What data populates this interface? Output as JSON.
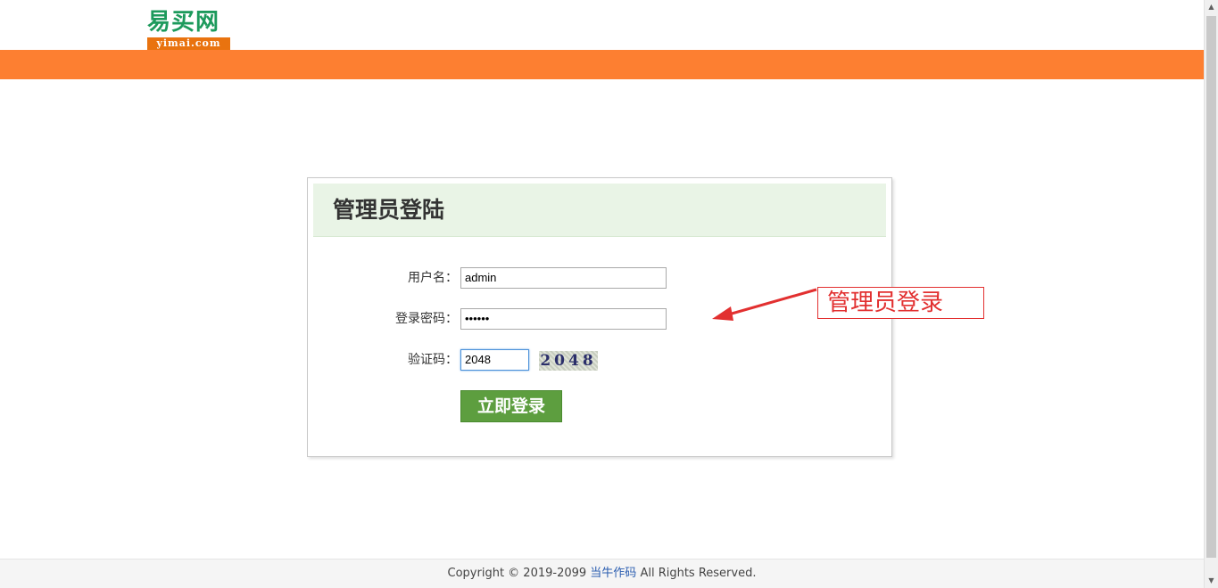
{
  "header": {
    "logo_cn": "易买网",
    "logo_en": "yimai.com"
  },
  "login": {
    "title": "管理员登陆",
    "username_label": "用户名：",
    "username_value": "admin",
    "password_label": "登录密码：",
    "password_value": "••••••",
    "captcha_label": "验证码：",
    "captcha_value": "2048",
    "captcha_image_text": "2048",
    "submit_label": "立即登录"
  },
  "annotation": {
    "text": "管理员登录",
    "color": "#e23030"
  },
  "footer": {
    "prefix": "Copyright © 2019-2099 ",
    "link": "当牛作码",
    "suffix": " All Rights Reserved."
  },
  "colors": {
    "orange_band": "#fd7f31",
    "login_button": "#5d9e3f",
    "login_head_bg": "#e9f4e6",
    "logo_green": "#1d9a5c",
    "logo_orange": "#e9730f"
  }
}
